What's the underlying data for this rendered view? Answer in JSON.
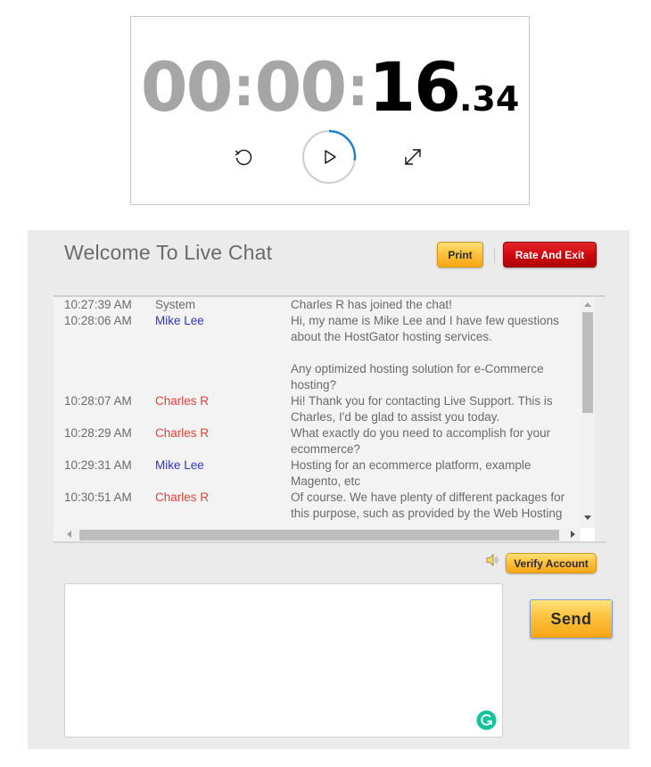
{
  "timer": {
    "hours": "00",
    "minutes": "00",
    "seconds": "16",
    "fraction": ".34",
    "separator": ":",
    "progress_fraction_of_minute": 0.27,
    "progress_color": "#1b7fd1",
    "controls": [
      {
        "name": "reset",
        "icon": "reset-icon"
      },
      {
        "name": "play",
        "icon": "play-icon"
      },
      {
        "name": "expand",
        "icon": "expand-icon"
      }
    ]
  },
  "chat": {
    "title": "Welcome To Live Chat",
    "print_label": "Print",
    "rate_exit_label": "Rate And Exit",
    "verify_label": "Verify Account",
    "send_label": "Send",
    "message_placeholder": "",
    "message_value": "",
    "colors": {
      "agent": "#e2403a",
      "user": "#3333bb",
      "system": "#6a6a6a",
      "button_yellow": "#ffc23d",
      "button_red": "#cc0a0f",
      "grammarly": "#15c39a"
    },
    "messages": [
      {
        "time": "10:27:39 AM",
        "sender": "System",
        "role": "system",
        "text": "Charles R has joined the chat!"
      },
      {
        "time": "10:28:06 AM",
        "sender": "Mike Lee",
        "role": "user",
        "text": "Hi, my name is Mike Lee and I have few questions about the HostGator hosting services.\n\nAny optimized hosting solution for e-Commerce hosting?"
      },
      {
        "time": "10:28:07 AM",
        "sender": "Charles R",
        "role": "agent",
        "text": "Hi! Thank you for contacting Live Support. This is Charles, I'd be glad to assist you today."
      },
      {
        "time": "10:28:29 AM",
        "sender": "Charles R",
        "role": "agent",
        "text": "What exactly do you need to accomplish for your ecommerce?"
      },
      {
        "time": "10:29:31 AM",
        "sender": "Mike Lee",
        "role": "user",
        "text": "Hosting for an ecommerce platform, example Magento, etc"
      },
      {
        "time": "10:30:51 AM",
        "sender": "Charles R",
        "role": "agent",
        "text": "Of course. We have plenty of different packages for this purpose, such as provided by the Web Hosting"
      }
    ]
  }
}
